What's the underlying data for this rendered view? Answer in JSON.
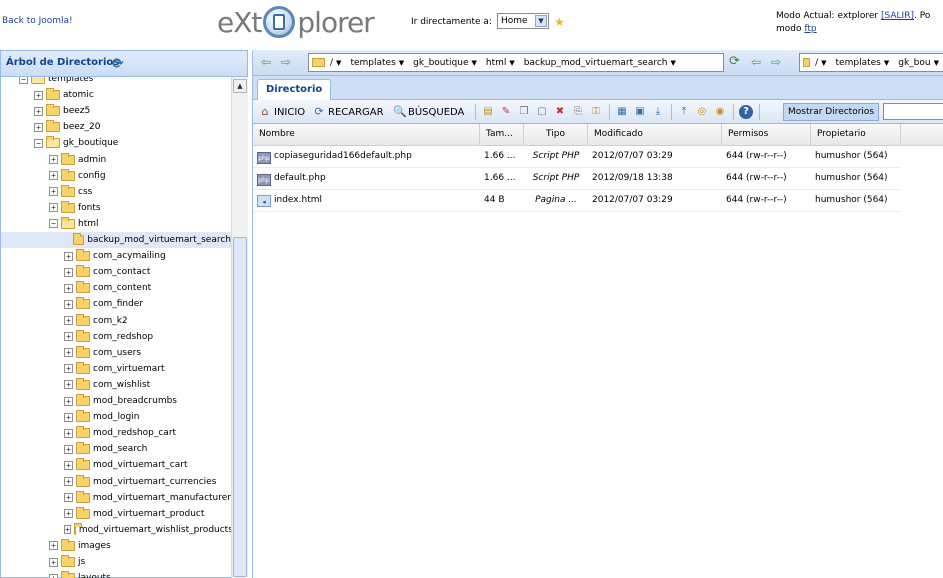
{
  "header": {
    "back_link": "Back to Joomla!",
    "logo_left": "eXt",
    "logo_right": "plorer",
    "goto_label": "Ir directamente a:",
    "goto_value": "Home",
    "mode_line1_prefix": "Modo Actual: extplorer ",
    "mode_line1_link": "[SALIR]",
    "mode_line1_suffix": ". Po",
    "mode_line2_prefix": "modo ",
    "mode_line2_link": "ftp"
  },
  "tree": {
    "title": "Árbol de Directorios",
    "items": [
      {
        "label": "templates",
        "depth": 0,
        "expander": "-",
        "open": true
      },
      {
        "label": "atomic",
        "depth": 1,
        "expander": "+",
        "open": false
      },
      {
        "label": "beez5",
        "depth": 1,
        "expander": "+",
        "open": false
      },
      {
        "label": "beez_20",
        "depth": 1,
        "expander": "+",
        "open": false
      },
      {
        "label": "gk_boutique",
        "depth": 1,
        "expander": "-",
        "open": true
      },
      {
        "label": "admin",
        "depth": 2,
        "expander": "+",
        "open": false
      },
      {
        "label": "config",
        "depth": 2,
        "expander": "+",
        "open": false
      },
      {
        "label": "css",
        "depth": 2,
        "expander": "+",
        "open": false
      },
      {
        "label": "fonts",
        "depth": 2,
        "expander": "+",
        "open": false
      },
      {
        "label": "html",
        "depth": 2,
        "expander": "-",
        "open": true
      },
      {
        "label": "backup_mod_virtuemart_search",
        "depth": 3,
        "expander": "",
        "open": false,
        "selected": true
      },
      {
        "label": "com_acymailing",
        "depth": 3,
        "expander": "+",
        "open": false
      },
      {
        "label": "com_contact",
        "depth": 3,
        "expander": "+",
        "open": false
      },
      {
        "label": "com_content",
        "depth": 3,
        "expander": "+",
        "open": false
      },
      {
        "label": "com_finder",
        "depth": 3,
        "expander": "+",
        "open": false
      },
      {
        "label": "com_k2",
        "depth": 3,
        "expander": "+",
        "open": false
      },
      {
        "label": "com_redshop",
        "depth": 3,
        "expander": "+",
        "open": false
      },
      {
        "label": "com_users",
        "depth": 3,
        "expander": "+",
        "open": false
      },
      {
        "label": "com_virtuemart",
        "depth": 3,
        "expander": "+",
        "open": false
      },
      {
        "label": "com_wishlist",
        "depth": 3,
        "expander": "+",
        "open": false
      },
      {
        "label": "mod_breadcrumbs",
        "depth": 3,
        "expander": "+",
        "open": false
      },
      {
        "label": "mod_login",
        "depth": 3,
        "expander": "+",
        "open": false
      },
      {
        "label": "mod_redshop_cart",
        "depth": 3,
        "expander": "+",
        "open": false
      },
      {
        "label": "mod_search",
        "depth": 3,
        "expander": "+",
        "open": false
      },
      {
        "label": "mod_virtuemart_cart",
        "depth": 3,
        "expander": "+",
        "open": false
      },
      {
        "label": "mod_virtuemart_currencies",
        "depth": 3,
        "expander": "+",
        "open": false
      },
      {
        "label": "mod_virtuemart_manufacturer",
        "depth": 3,
        "expander": "+",
        "open": false
      },
      {
        "label": "mod_virtuemart_product",
        "depth": 3,
        "expander": "+",
        "open": false
      },
      {
        "label": "mod_virtuemart_wishlist_products",
        "depth": 3,
        "expander": "+",
        "open": false
      },
      {
        "label": "images",
        "depth": 2,
        "expander": "+",
        "open": false
      },
      {
        "label": "js",
        "depth": 2,
        "expander": "+",
        "open": false
      },
      {
        "label": "layouts",
        "depth": 2,
        "expander": "+",
        "open": false
      }
    ]
  },
  "path_left": {
    "segments": [
      "/",
      "templates",
      "gk_boutique",
      "html",
      "backup_mod_virtuemart_search"
    ]
  },
  "path_right": {
    "segments": [
      "/",
      "templates",
      "gk_bou"
    ]
  },
  "tabs": {
    "directory": "Directorio"
  },
  "toolbar": {
    "home": "INICIO",
    "reload": "RECARGAR",
    "search": "BÚSQUEDA",
    "show_dirs": "Mostrar Directorios"
  },
  "grid": {
    "columns": [
      "Nombre",
      "Tam...",
      "Tipo",
      "Modificado",
      "Permisos",
      "Propietario"
    ],
    "rows": [
      {
        "icon": "php",
        "name": "copiaseguridad166default.php",
        "size": "1.66 ...",
        "type": "Script PHP",
        "modified": "2012/07/07 03:29",
        "perms": "644 (rw-r--r--)",
        "owner": "humushor (564)"
      },
      {
        "icon": "php",
        "name": "default.php",
        "size": "1.66 ...",
        "type": "Script PHP",
        "modified": "2012/09/18 13:38",
        "perms": "644 (rw-r--r--)",
        "owner": "humushor (564)"
      },
      {
        "icon": "html",
        "name": "index.html",
        "size": "44 B",
        "type": "Pagina ...",
        "modified": "2012/07/07 03:29",
        "perms": "644 (rw-r--r--)",
        "owner": "humushor (564)"
      }
    ]
  },
  "colors": {
    "panel_border": "#99bbe8",
    "header_text": "#15428b",
    "link": "#1c3f95",
    "selected_row": "#dfe8f6"
  }
}
